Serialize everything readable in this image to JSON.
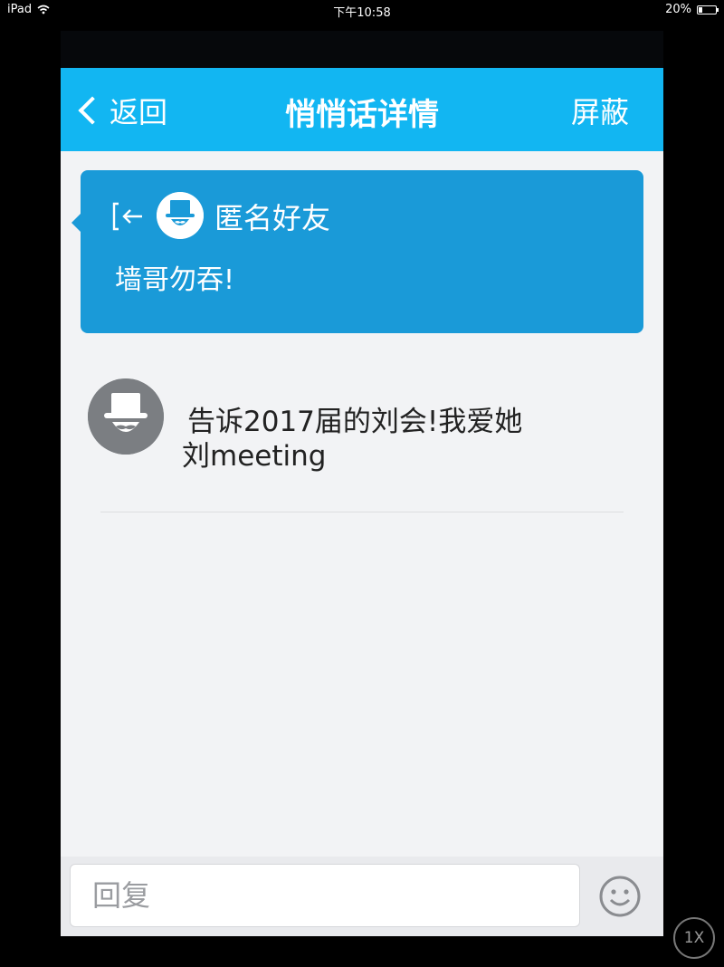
{
  "status_bar": {
    "device": "iPad",
    "time": "下午10:58",
    "battery": "20%",
    "battery_level": 0.2
  },
  "navbar": {
    "back_label": "返回",
    "title": "悄悄话详情",
    "right_label": "屏蔽"
  },
  "card": {
    "sender": "匿名好友",
    "message": "墙哥勿吞!"
  },
  "post": {
    "line1": "告诉2017届的刘会!我爱她",
    "line2": "刘meeting"
  },
  "reply": {
    "placeholder": "回复"
  },
  "zoom": {
    "label": "1X"
  },
  "colors": {
    "navbar": "#12b6f2",
    "card": "#1a9ad8",
    "background": "#f2f3f5",
    "avatar_gray": "#7b7e82"
  },
  "icons": {
    "exit": "exit-icon",
    "emoji": "smiley-icon",
    "wifi": "wifi-icon",
    "battery": "battery-icon"
  }
}
